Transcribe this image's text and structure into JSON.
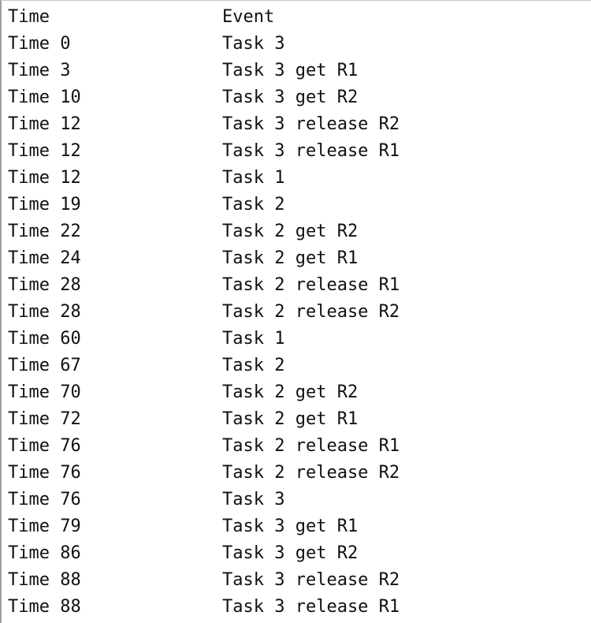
{
  "log": {
    "header": {
      "time": "Time",
      "event": "Event"
    },
    "rows": [
      {
        "time": "Time 0",
        "event": "Task 3"
      },
      {
        "time": "Time 3",
        "event": "Task 3 get R1"
      },
      {
        "time": "Time 10",
        "event": "Task 3 get R2"
      },
      {
        "time": "Time 12",
        "event": "Task 3 release R2"
      },
      {
        "time": "Time 12",
        "event": "Task 3 release R1"
      },
      {
        "time": "Time 12",
        "event": "Task 1"
      },
      {
        "time": "Time 19",
        "event": "Task 2"
      },
      {
        "time": "Time 22",
        "event": "Task 2 get R2"
      },
      {
        "time": "Time 24",
        "event": "Task 2 get R1"
      },
      {
        "time": "Time 28",
        "event": "Task 2 release R1"
      },
      {
        "time": "Time 28",
        "event": "Task 2 release R2"
      },
      {
        "time": "Time 60",
        "event": "Task 1"
      },
      {
        "time": "Time 67",
        "event": "Task 2"
      },
      {
        "time": "Time 70",
        "event": "Task 2 get R2"
      },
      {
        "time": "Time 72",
        "event": "Task 2 get R1"
      },
      {
        "time": "Time 76",
        "event": "Task 2 release R1"
      },
      {
        "time": "Time 76",
        "event": "Task 2 release R2"
      },
      {
        "time": "Time 76",
        "event": "Task 3"
      },
      {
        "time": "Time 79",
        "event": "Task 3 get R1"
      },
      {
        "time": "Time 86",
        "event": "Task 3 get R2"
      },
      {
        "time": "Time 88",
        "event": "Task 3 release R2"
      },
      {
        "time": "Time 88",
        "event": "Task 3 release R1"
      }
    ]
  }
}
